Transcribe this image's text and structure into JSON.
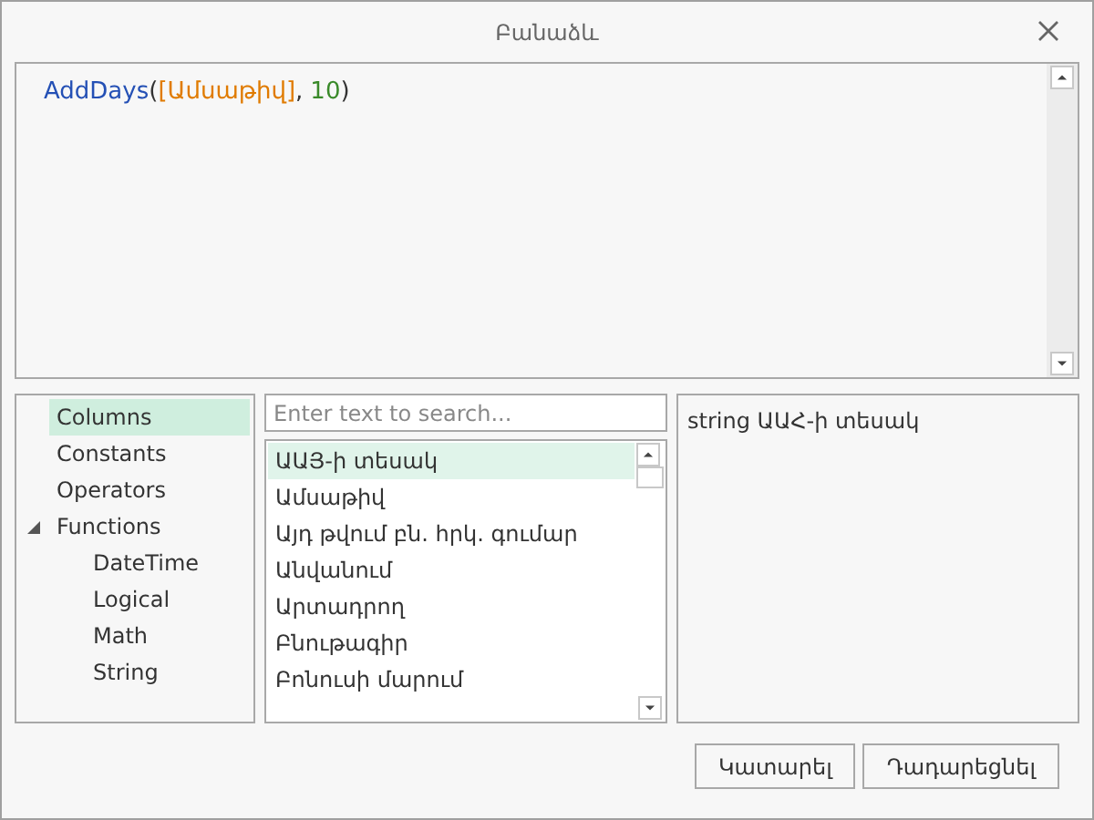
{
  "window": {
    "title": "Բանաձև"
  },
  "expression": [
    {
      "kind": "function",
      "text": "AddDays"
    },
    {
      "kind": "punct",
      "text": "("
    },
    {
      "kind": "field",
      "text": "[Ամսաթիվ]"
    },
    {
      "kind": "punct",
      "text": ","
    },
    {
      "kind": "number",
      "text": "10"
    },
    {
      "kind": "punct",
      "text": ")"
    }
  ],
  "tree": [
    {
      "label": "Columns",
      "selected": true
    },
    {
      "label": "Constants",
      "selected": false
    },
    {
      "label": "Operators",
      "selected": false
    },
    {
      "label": "Functions",
      "selected": false,
      "expanded": true,
      "children": [
        {
          "label": "DateTime",
          "selected": false
        },
        {
          "label": "Logical",
          "selected": false
        },
        {
          "label": "Math",
          "selected": false
        },
        {
          "label": "String",
          "selected": false
        }
      ]
    }
  ],
  "search": {
    "placeholder": "Enter text to search..."
  },
  "items": [
    {
      "label": "ԱԱՅ-ի տեսակ",
      "selected": true
    },
    {
      "label": "Ամսաթիվ",
      "selected": false
    },
    {
      "label": "Այդ թվում բն. հրկ. գումար",
      "selected": false
    },
    {
      "label": "Անվանում",
      "selected": false
    },
    {
      "label": "Արտադրող",
      "selected": false
    },
    {
      "label": "Բնութագիր",
      "selected": false
    },
    {
      "label": "Բոնուսի մարում",
      "selected": false
    }
  ],
  "description": "string ԱԱՀ-ի տեսակ",
  "buttons": [
    "Կատարել",
    "Դադարեցնել"
  ]
}
